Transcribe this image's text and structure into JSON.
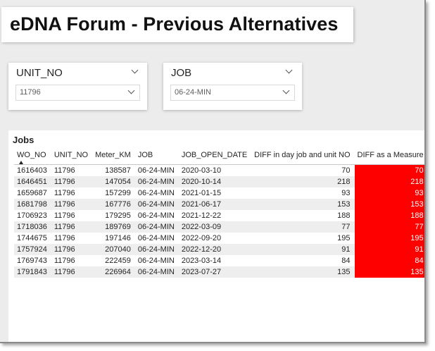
{
  "page_title": "eDNA Forum - Previous Alternatives",
  "slicers": {
    "unit": {
      "title": "UNIT_NO",
      "value": "11796"
    },
    "job": {
      "title": "JOB",
      "value": "06-24-MIN"
    }
  },
  "jobs_table": {
    "title": "Jobs",
    "columns": [
      "WO_NO",
      "UNIT_NO",
      "Meter_KM",
      "JOB",
      "JOB_OPEN_DATE",
      "DIFF in day job and unit NO",
      "DIFF as a Measure"
    ],
    "rows": [
      [
        "1616403",
        "11796",
        "138587",
        "06-24-MIN",
        "2020-03-10",
        "70",
        "70"
      ],
      [
        "1646451",
        "11796",
        "147054",
        "06-24-MIN",
        "2020-10-14",
        "218",
        "218"
      ],
      [
        "1659687",
        "11796",
        "157299",
        "06-24-MIN",
        "2021-01-15",
        "93",
        "93"
      ],
      [
        "1681798",
        "11796",
        "167776",
        "06-24-MIN",
        "2021-06-17",
        "153",
        "153"
      ],
      [
        "1706923",
        "11796",
        "179295",
        "06-24-MIN",
        "2021-12-22",
        "188",
        "188"
      ],
      [
        "1718036",
        "11796",
        "189769",
        "06-24-MIN",
        "2022-03-09",
        "77",
        "77"
      ],
      [
        "1744675",
        "11796",
        "197146",
        "06-24-MIN",
        "2022-09-20",
        "195",
        "195"
      ],
      [
        "1757924",
        "11796",
        "207040",
        "06-24-MIN",
        "2022-12-20",
        "91",
        "91"
      ],
      [
        "1769743",
        "11796",
        "222459",
        "06-24-MIN",
        "2023-03-14",
        "84",
        "84"
      ],
      [
        "1791843",
        "11796",
        "226964",
        "06-24-MIN",
        "2023-07-27",
        "135",
        "135"
      ]
    ],
    "measure_color": "#ff0000"
  },
  "icons": {
    "slicer_header": "chevron-down-icon",
    "dropdown": "chevron-down-icon",
    "sort": "sort-ascending-icon"
  }
}
